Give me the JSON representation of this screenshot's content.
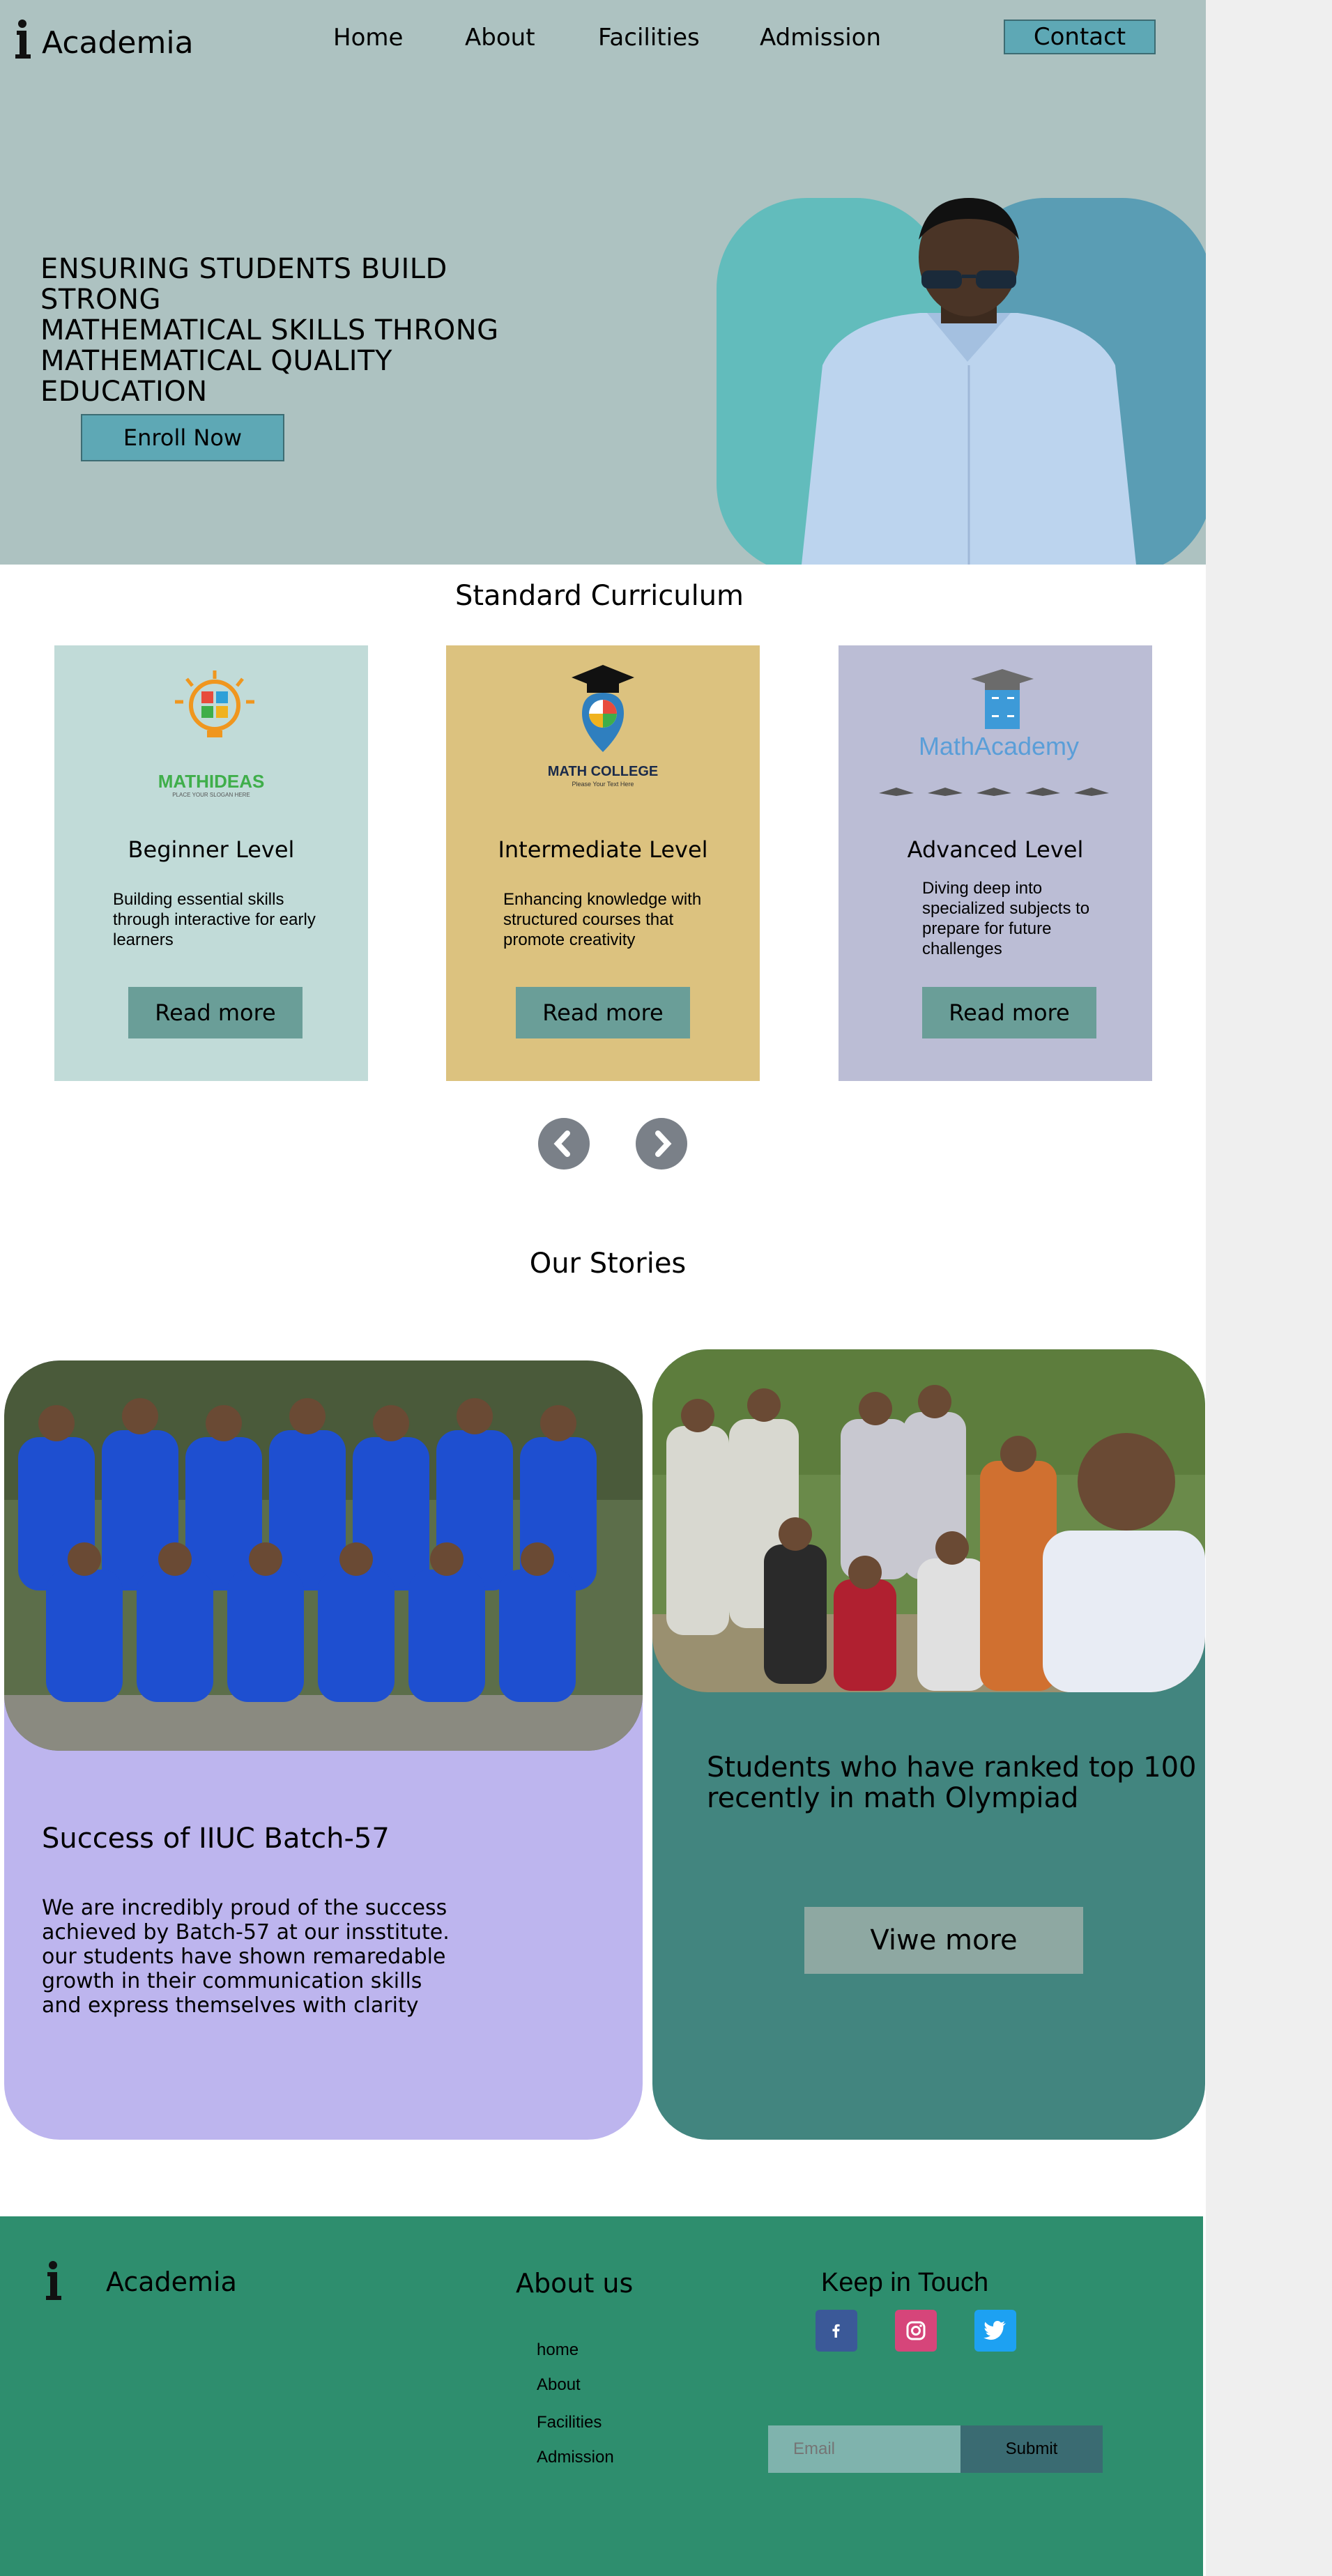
{
  "brand": {
    "name": "Academia",
    "footer_name": "Academia"
  },
  "nav": {
    "items": [
      "Home",
      "About",
      "Facilities",
      "Admission"
    ],
    "contact": "Contact"
  },
  "hero": {
    "title_lines": [
      "ENSURING STUDENTS BUILD STRONG",
      "MATHEMATICAL SKILLS THRONG",
      "MATHEMATICAL QUALITY",
      "EDUCATION"
    ],
    "enroll": "Enroll Now"
  },
  "curriculum": {
    "title": "Standard Curriculum",
    "cards": [
      {
        "logo_text": "MATHIDEAS",
        "logo_sub": "PLACE YOUR SLOGAN HERE",
        "title": "Beginner  Level",
        "description": "Building essential skills through interactive for early learners",
        "button": "Read more",
        "color": "#c1dbd8"
      },
      {
        "logo_text": "MATH COLLEGE",
        "logo_sub": "Please Your Text Here",
        "title": "Intermediate  Level",
        "description": "Enhancing knowledge with structured courses that promote creativity",
        "button": "Read more",
        "color": "#dcc27f"
      },
      {
        "logo_text": "MathAcademy",
        "logo_sub": "",
        "title": "Advanced  Level",
        "description": "Diving deep into specialized subjects to prepare for future challenges",
        "button": "Read more",
        "color": "#bbbdd5"
      }
    ]
  },
  "stories": {
    "title": "Our Stories",
    "left": {
      "heading": "Success of IIUC Batch-57",
      "body_lines": [
        "We are incredibly proud of the success",
        "achieved by Batch-57 at our insstitute.",
        "our students have shown remaredable",
        "growth in their communication skills",
        "and express themselves with clarity"
      ]
    },
    "right": {
      "heading_lines": [
        "Students  who have ranked top 100",
        "recently in math Olympiad"
      ],
      "button": "Viwe more"
    }
  },
  "footer": {
    "about_title": "About us",
    "links": [
      "home",
      "About",
      "Facilities",
      "Admission"
    ],
    "touch_title": "Keep  in  Touch",
    "social": [
      "facebook-icon",
      "instagram-icon",
      "twitter-icon"
    ],
    "email_placeholder": "Email",
    "submit": "Submit"
  },
  "colors": {
    "hero_bg": "#adc2c1",
    "accent": "#5ea8b5",
    "footer_bg": "#2e8e6e",
    "story_left": "#bdb5ee",
    "story_right": "#42857f"
  }
}
